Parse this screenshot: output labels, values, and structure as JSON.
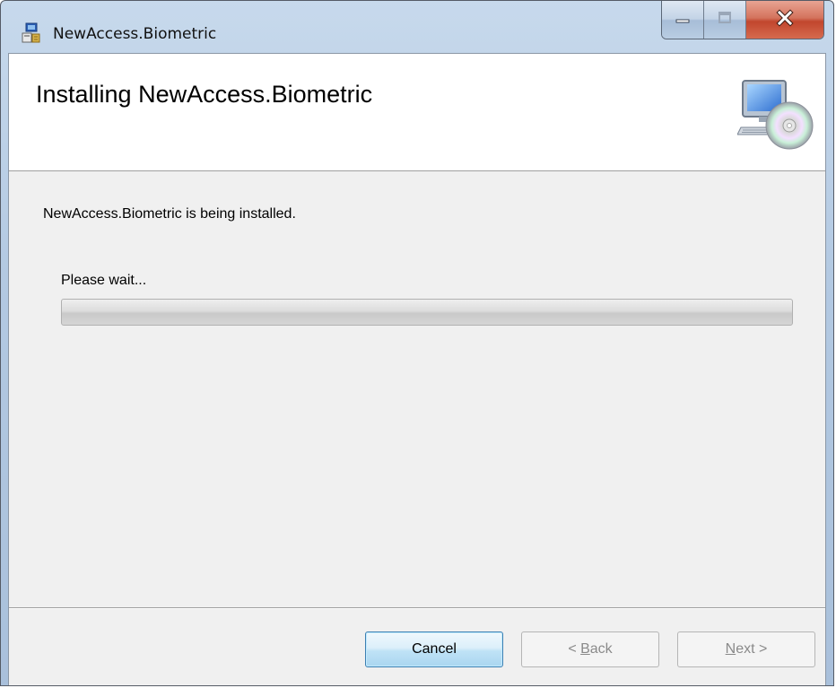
{
  "window": {
    "title": "NewAccess.Biometric"
  },
  "banner": {
    "title": "Installing NewAccess.Biometric",
    "icon": "computer-disc-icon"
  },
  "main": {
    "status": "NewAccess.Biometric is being installed.",
    "wait_label": "Please wait...",
    "progress_percent": 0
  },
  "buttons": {
    "cancel": "Cancel",
    "back_prefix": "< ",
    "back_mnemonic": "B",
    "back_rest": "ack",
    "next_mnemonic": "N",
    "next_rest": "ext >"
  },
  "icons": {
    "app": "installer-icon",
    "minimize": "minimize-icon",
    "maximize": "maximize-icon",
    "close": "close-icon"
  },
  "colors": {
    "close_button": "#c1462d",
    "default_button_border": "#3c7fb1"
  }
}
